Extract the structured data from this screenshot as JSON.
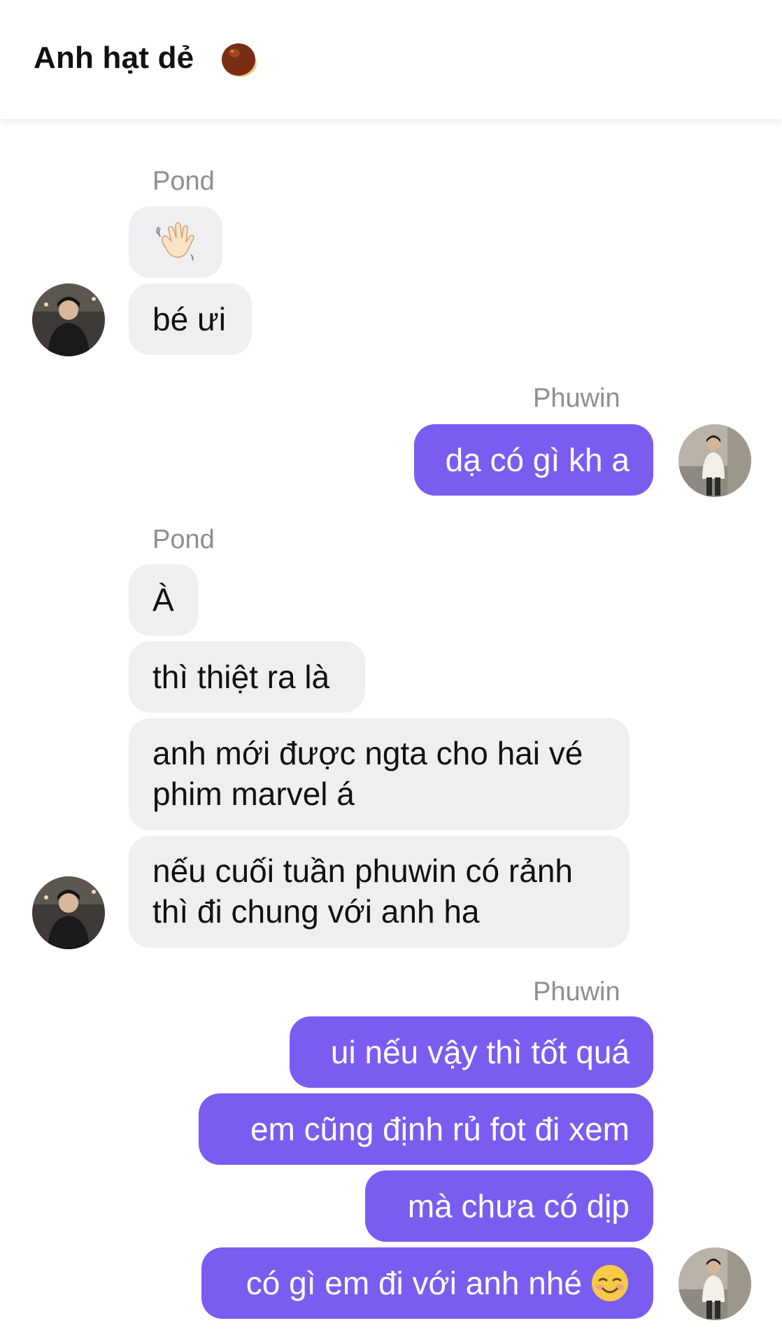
{
  "header": {
    "title": "Anh hạt dẻ",
    "emoji_icon": "chestnut-icon"
  },
  "messages": {
    "g1_sender": "Pond",
    "g1_m1_emoji": "waving-hand-emoji",
    "g1_m2": "bé ưi",
    "g2_sender": "Phuwin",
    "g2_m1": "dạ có gì kh a",
    "g3_sender": "Pond",
    "g3_m1": "À",
    "g3_m2": "thì thiệt ra là",
    "g3_m3_line1": "anh mới được ngta cho hai vé",
    "g3_m3_line2": "phim marvel á",
    "g3_m4_line1": "nếu cuối tuần phuwin có rảnh",
    "g3_m4_line2": "thì đi chung với anh ha",
    "g4_sender": "Phuwin",
    "g4_m1": "ui nếu vậy thì tốt quá",
    "g4_m2": "em cũng định rủ fot đi xem",
    "g4_m3": "mà chưa có dịp",
    "g4_m4": "có gì em đi với anh nhé",
    "g4_m4_emoji": "smiling-face-emoji"
  },
  "colors": {
    "outgoing_bubble": "#7b5cf0",
    "incoming_bubble": "#efeff2",
    "sender_label": "#8e8e93"
  }
}
